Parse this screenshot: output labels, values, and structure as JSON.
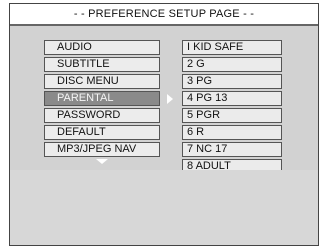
{
  "header": {
    "title": "- - PREFERENCE SETUP PAGE - -"
  },
  "left_menu": {
    "items": [
      {
        "label": "AUDIO"
      },
      {
        "label": "SUBTITLE"
      },
      {
        "label": "DISC MENU"
      },
      {
        "label": "PARENTAL"
      },
      {
        "label": "PASSWORD"
      },
      {
        "label": "DEFAULT"
      },
      {
        "label": "MP3/JPEG NAV"
      }
    ],
    "selected": "PARENTAL"
  },
  "right_menu": {
    "items": [
      {
        "label": "I KID SAFE"
      },
      {
        "label": "2 G"
      },
      {
        "label": "3 PG"
      },
      {
        "label": "4 PG 13"
      },
      {
        "label": "5 PGR"
      },
      {
        "label": "6 R"
      },
      {
        "label": "7 NC 17"
      },
      {
        "label": "8 ADULT"
      }
    ]
  },
  "colors": {
    "panel": "#d2d2d2",
    "item": "#ececec",
    "selected": "#8a8a8a"
  },
  "icons": [
    "right-arrow-icon",
    "down-arrow-icon"
  ]
}
